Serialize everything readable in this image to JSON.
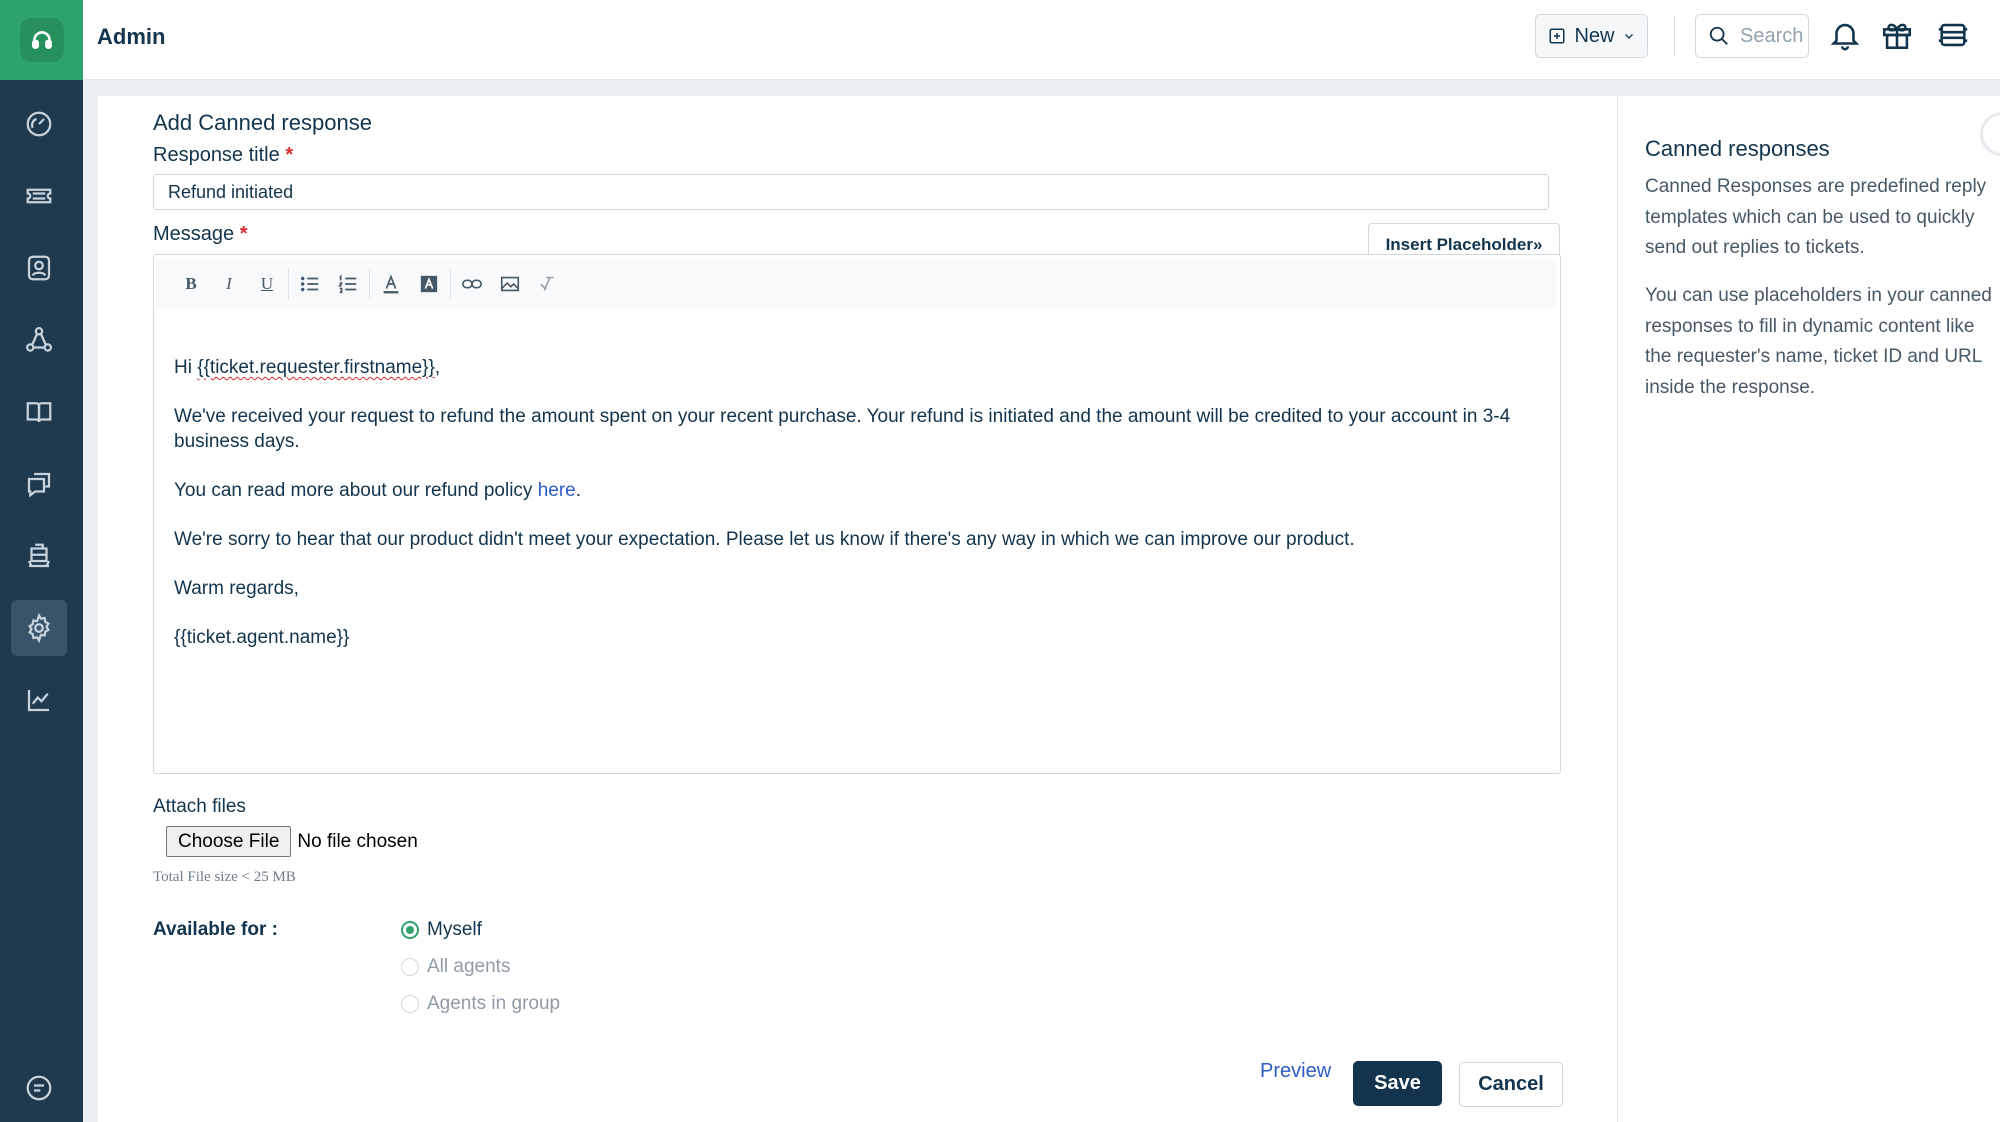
{
  "header": {
    "title": "Admin",
    "new_label": "New",
    "search_placeholder": "Search"
  },
  "sidebar": {
    "items": [
      {
        "name": "dashboard",
        "icon": "gauge-icon"
      },
      {
        "name": "tickets",
        "icon": "ticket-icon"
      },
      {
        "name": "contacts",
        "icon": "contact-card-icon"
      },
      {
        "name": "groups",
        "icon": "network-icon"
      },
      {
        "name": "solutions",
        "icon": "book-icon"
      },
      {
        "name": "forums",
        "icon": "chat-bubbles-icon"
      },
      {
        "name": "assets",
        "icon": "ship-icon"
      },
      {
        "name": "admin",
        "icon": "gear-icon",
        "active": true
      },
      {
        "name": "reports",
        "icon": "trend-chart-icon"
      },
      {
        "name": "help",
        "icon": "chat-help-icon"
      }
    ]
  },
  "form": {
    "section_title": "Add Canned response",
    "title_label": "Response title",
    "title_value": "Refund initiated",
    "message_label": "Message",
    "required_mark": "*",
    "insert_placeholder_label": "Insert Placeholder»",
    "toolbar": {
      "bold": "B",
      "italic": "I",
      "underline": "U"
    },
    "message": {
      "greeting_prefix": "Hi ",
      "greeting_placeholder": "{{ticket.requester.firstname}}",
      "greeting_suffix": ",",
      "paragraph1": "We've received your request to refund the amount spent on your recent purchase. Your refund is initiated and the amount will be credited to your account in 3-4 business days.",
      "paragraph2_prefix": "You can read more about our refund policy ",
      "paragraph2_link": "here",
      "paragraph2_suffix": ".",
      "paragraph3": "We're sorry to hear that our product didn't meet your expectation. Please let us know if there's any way in which we can improve our product.",
      "closing": "Warm regards,",
      "signature": "{{ticket.agent.name}}"
    },
    "attach_label": "Attach files",
    "choose_file_label": "Choose File",
    "file_status": "No file chosen",
    "file_hint": "Total File size < 25 MB",
    "available_label": "Available for :",
    "options": [
      {
        "label": "Myself",
        "selected": true
      },
      {
        "label": "All agents",
        "selected": false
      },
      {
        "label": "Agents in group",
        "selected": false
      }
    ],
    "preview_label": "Preview",
    "save_label": "Save",
    "cancel_label": "Cancel"
  },
  "side_panel": {
    "title": "Canned responses",
    "text1": "Canned Responses are predefined reply templates which can be used to quickly send out replies to tickets.",
    "text2": "You can use placeholders in your canned responses to fill in dynamic content like the requester's name, ticket ID and URL inside the response."
  },
  "colors": {
    "sidebar_bg": "#1f3a4f",
    "brand_green": "#2ea36b",
    "primary_dark": "#12344d",
    "link_blue": "#2c5cc5",
    "required_red": "#d72d30"
  }
}
